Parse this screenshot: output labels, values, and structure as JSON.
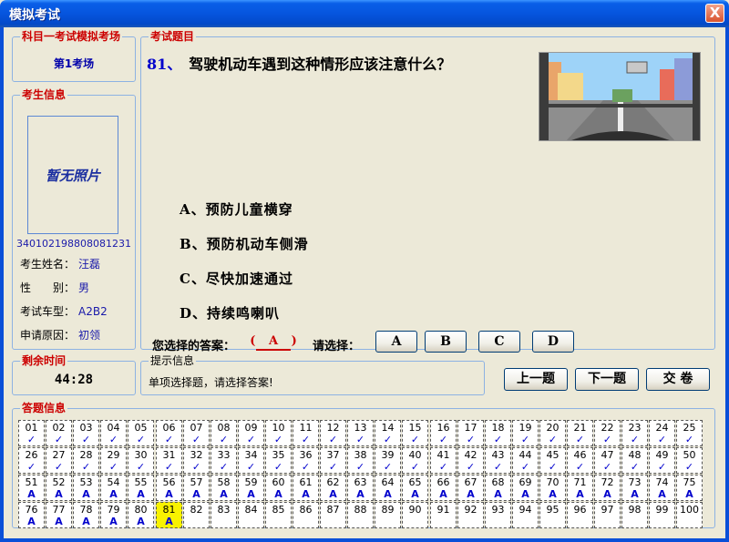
{
  "window": {
    "title": "模拟考试",
    "close_label": "X"
  },
  "exam_room": {
    "legend": "科目一考试模拟考场",
    "room": "第1考场"
  },
  "candidate": {
    "legend": "考生信息",
    "photo_placeholder": "暂无照片",
    "id_number": "340102198808081231",
    "fields": [
      {
        "label": "考生姓名：",
        "value": "汪磊"
      },
      {
        "label": "性　　别：",
        "value": "男"
      },
      {
        "label": "考试车型：",
        "value": "A2B2"
      },
      {
        "label": "申请原因：",
        "value": "初领"
      }
    ]
  },
  "question": {
    "legend": "考试题目",
    "number": "81、",
    "text": "驾驶机动车遇到这种情形应该注意什么？",
    "options": [
      "A、预防儿童横穿",
      "B、预防机动车侧滑",
      "C、尽快加速通过",
      "D、持续鸣喇叭"
    ],
    "answer_label": "您选择的答案：",
    "answer_open": "(",
    "answer_value": "A",
    "answer_close": ")",
    "select_label": "请选择：",
    "choice_buttons": [
      "A",
      "B",
      "C",
      "D"
    ]
  },
  "timer": {
    "legend": "剩余时间",
    "value": "44:28"
  },
  "hint": {
    "legend": "提示信息",
    "text": "单项选择题，请选择答案!"
  },
  "nav": {
    "prev": "上一题",
    "next": "下一题",
    "submit": "交 卷"
  },
  "answers": {
    "legend": "答题信息",
    "current": 81,
    "marks": [
      "✓",
      "✓",
      "✓",
      "✓",
      "✓",
      "✓",
      "✓",
      "✓",
      "✓",
      "✓",
      "✓",
      "✓",
      "✓",
      "✓",
      "✓",
      "✓",
      "✓",
      "✓",
      "✓",
      "✓",
      "✓",
      "✓",
      "✓",
      "✓",
      "✓",
      "✓",
      "✓",
      "✓",
      "✓",
      "✓",
      "✓",
      "✓",
      "✓",
      "✓",
      "✓",
      "✓",
      "✓",
      "✓",
      "✓",
      "✓",
      "✓",
      "✓",
      "✓",
      "✓",
      "✓",
      "✓",
      "✓",
      "✓",
      "✓",
      "✓",
      "A",
      "A",
      "A",
      "A",
      "A",
      "A",
      "A",
      "A",
      "A",
      "A",
      "A",
      "A",
      "A",
      "A",
      "A",
      "A",
      "A",
      "A",
      "A",
      "A",
      "A",
      "A",
      "A",
      "A",
      "A",
      "A",
      "A",
      "A",
      "A",
      "A",
      "A",
      "",
      "",
      "",
      "",
      "",
      "",
      "",
      "",
      "",
      "",
      "",
      "",
      "",
      "",
      "",
      "",
      "",
      "",
      ""
    ]
  },
  "colors": {
    "accent": "#0A4FD8",
    "legend_red": "#CC0000",
    "answer_blue": "#0000CC",
    "current_cell": "#F8F200"
  }
}
